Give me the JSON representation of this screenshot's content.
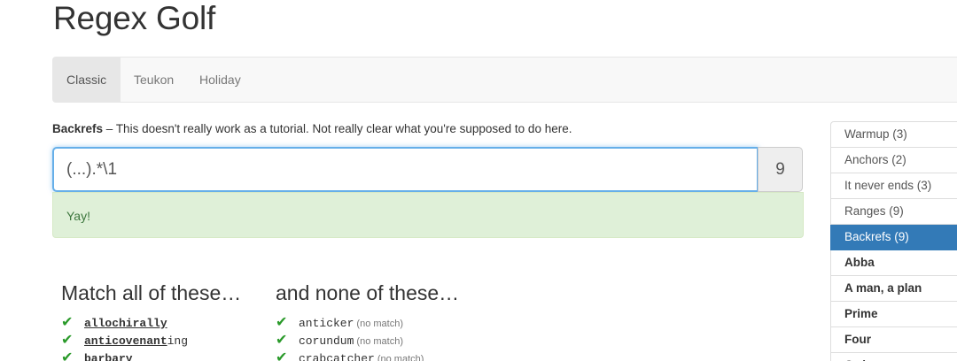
{
  "title": "Regex Golf",
  "tabs": [
    {
      "label": "Classic"
    },
    {
      "label": "Teukon"
    },
    {
      "label": "Holiday"
    }
  ],
  "level": {
    "name": "Backrefs",
    "description": " – This doesn't really work as a tutorial. Not really clear what you're supposed to do here."
  },
  "regex": {
    "value": "(...).*\\1",
    "score": "9"
  },
  "alert": "Yay!",
  "match": {
    "heading": "Match all of these…",
    "words": [
      {
        "matched": "allochirally",
        "rest": ""
      },
      {
        "matched": "anticovenant",
        "rest": "ing"
      },
      {
        "matched": "barbary",
        "rest": ""
      }
    ]
  },
  "nomatch": {
    "heading": "and none of these…",
    "words": [
      {
        "word": "anticker",
        "note": "(no match)"
      },
      {
        "word": "corundum",
        "note": "(no match)"
      },
      {
        "word": "crabcatcher",
        "note": "(no match)"
      }
    ]
  },
  "sidebar": [
    {
      "label": "Warmup (3)"
    },
    {
      "label": "Anchors (2)"
    },
    {
      "label": "It never ends (3)"
    },
    {
      "label": "Ranges (9)"
    },
    {
      "label": "Backrefs (9)"
    },
    {
      "label": "Abba"
    },
    {
      "label": "A man, a plan"
    },
    {
      "label": "Prime"
    },
    {
      "label": "Four"
    },
    {
      "label": "Order"
    }
  ],
  "colors": {
    "accent": "#337ab7",
    "success_bg": "#dff0d8",
    "check": "#2a9a2a"
  }
}
